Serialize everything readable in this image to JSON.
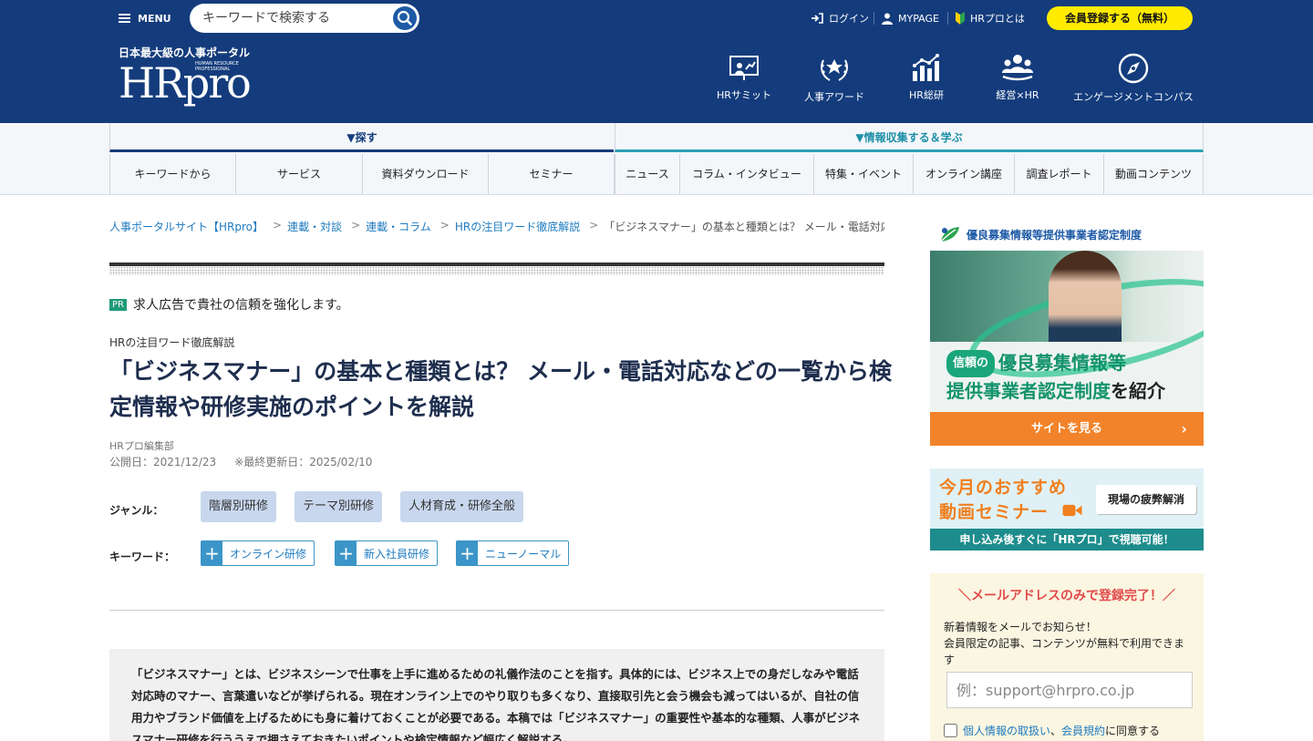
{
  "topbar": {
    "menu_label": "MENU",
    "search_placeholder": "キーワードで検索する",
    "login": "ログイン",
    "mypage": "MYPAGE",
    "about": "HRプロとは",
    "register": "会員登録する（無料）"
  },
  "header": {
    "logo_tagline": "日本最大級の人事ポータル",
    "logo_text": "HRpro",
    "logo_sub": "HUMAN RESOURCE PROFESSIONAL",
    "nav": [
      "HRサミット",
      "人事アワード",
      "HR総研",
      "経営×HR",
      "エンゲージメントコンパス"
    ]
  },
  "catnav": {
    "left_title": "▼探す",
    "right_title": "▼情報収集する＆学ぶ",
    "left_items": [
      "キーワードから",
      "サービス",
      "資料ダウンロード",
      "セミナー"
    ],
    "right_items": [
      "ニュース",
      "コラム・インタビュー",
      "特集・イベント",
      "オンライン講座",
      "調査レポート",
      "動画コンテンツ"
    ]
  },
  "breadcrumb": [
    "人事ポータルサイト【HRpro】",
    "連載・対談",
    "連載・コラム",
    "HRの注目ワード徹底解説",
    "「ビジネスマナー」の基本と種類とは？ メール・電話対応"
  ],
  "article": {
    "pr_badge": "PR",
    "pr_text": "求人広告で貴社の信頼を強化します。",
    "category": "HRの注目ワード徹底解説",
    "title": "「ビジネスマナー」の基本と種類とは？ メール・電話対応などの一覧から検定情報や研修実施のポイントを解説",
    "author": "HRプロ編集部",
    "published": "公開日：2021/12/23",
    "updated": "※最終更新日：2025/02/10",
    "genre_label": "ジャンル：",
    "genres": [
      "階層別研修",
      "テーマ別研修",
      "人材育成・研修全般"
    ],
    "keyword_label": "キーワード：",
    "keywords": [
      "オンライン研修",
      "新入社員研修",
      "ニューノーマル"
    ],
    "lead": "「ビジネスマナー」とは、ビジネスシーンで仕事を上手に進めるための礼儀作法のことを指す。具体的には、ビジネス上での身だしなみや電話対応時のマナー、言葉遣いなどが挙げられる。現在オンライン上でのやり取りも多くなり、直接取引先と会う機会も減ってはいるが、自社の信用力やブランド価値を上げるためにも身に着けておくことが必要である。本稿では「ビジネスマナー」の重要性や基本的な種類、人事がビジネスマナー研修を行ううえで押さえておきたいポイントや検定情報など幅広く解説する。"
  },
  "sidebar": {
    "cert_title": "優良募集情報等提供事業者認定制度",
    "ad1": {
      "pill": "信頼の",
      "line1": "優良募集情報等",
      "line2": "提供事業者認定制度",
      "line2_suffix": "を紹介",
      "button": "サイトを見る"
    },
    "ad2": {
      "line1": "今月のおすすめ",
      "line2": "動画セミナー",
      "box": "現場の疲弊解消",
      "bar": "申し込み後すぐに「HRプロ」で視聴可能！"
    },
    "signup": {
      "heading": "＼メールアドレスのみで登録完了！／",
      "text1": "新着情報をメールでお知らせ！",
      "text2": "会員限定の記事、コンテンツが無料で利用できます",
      "email_placeholder": "例：support@hrpro.co.jp",
      "privacy": "個人情報の取扱い",
      "comma": "、",
      "terms": "会員規約",
      "agree_suffix": "に同意する"
    }
  },
  "colors": {
    "brand_navy": "#143c7c",
    "accent_yellow": "#ffeb00",
    "link_blue": "#1e7abf",
    "cta_orange": "#f2832a"
  }
}
